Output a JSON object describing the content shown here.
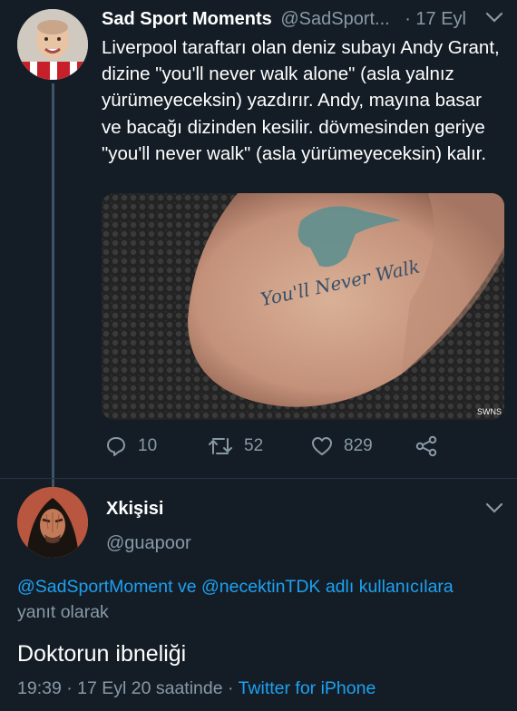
{
  "tweet": {
    "author_name": "Sad Sport Moments",
    "author_handle": "@SadSport...",
    "time": "· 17 Eyl",
    "text": "Liverpool taraftarı olan deniz subayı Andy Grant, dizine \"you'll never walk alone\" (asla yalnız yürümeyeceksin) yazdırır. Andy, mayına basar ve bacağı dizinden kesilir. dövmesinden geriye \"you'll never walk\" (asla yürümeyeceksin) kalır.",
    "image": {
      "tattoo_text": "You'll Never Walk",
      "watermark": "SWNS"
    },
    "actions": {
      "replies": "10",
      "retweets": "52",
      "likes": "829"
    },
    "icons": [
      "avatar",
      "chevron-down-icon",
      "reply-icon",
      "retweet-icon",
      "like-icon",
      "share-icon"
    ]
  },
  "reply": {
    "author_name": "Xkişisi",
    "author_handle": "@guapoor",
    "reply_to_user1": "@SadSportMoment",
    "reply_to_and": " ve ",
    "reply_to_user2": "@necektinTDK",
    "reply_to_suffix": " adlı kullanıcılara yanıt olarak",
    "text": "Doktorun ibneliği",
    "meta_time": "19:39 · 17 Eyl 20 saatinde · ",
    "meta_source": "Twitter for iPhone"
  },
  "colors": {
    "background": "#141d26",
    "secondary_text": "#8899a6",
    "link": "#1da1f2",
    "thread_line": "#3d5466"
  }
}
